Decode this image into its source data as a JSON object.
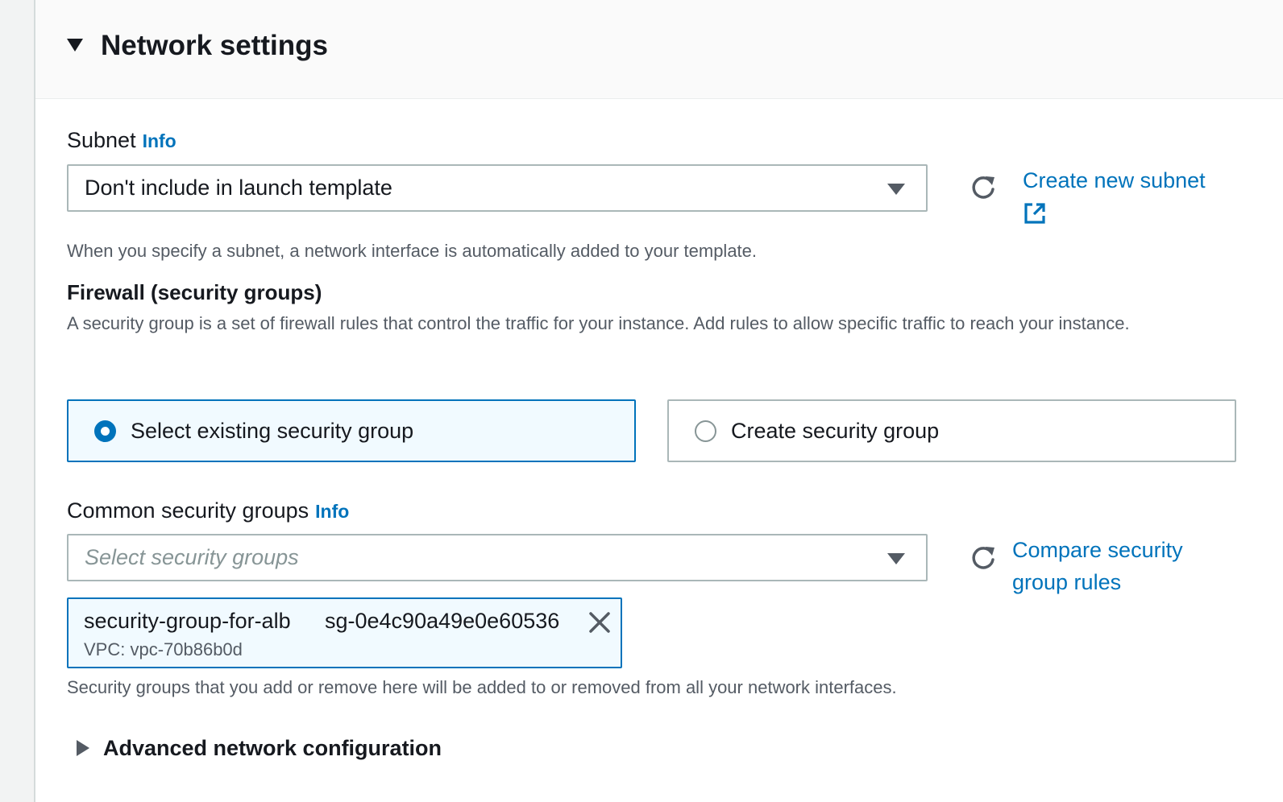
{
  "section": {
    "title": "Network settings"
  },
  "subnet": {
    "label": "Subnet",
    "info": "Info",
    "selected_value": "Don't include in launch template",
    "create_link": "Create new subnet",
    "help": "When you specify a subnet, a network interface is automatically added to your template."
  },
  "firewall": {
    "heading": "Firewall (security groups)",
    "description": "A security group is a set of firewall rules that control the traffic for your instance. Add rules to allow specific traffic to reach your instance.",
    "options": [
      {
        "label": "Select existing security group",
        "selected": true
      },
      {
        "label": "Create security group",
        "selected": false
      }
    ]
  },
  "common_sg": {
    "label": "Common security groups",
    "info": "Info",
    "placeholder": "Select security groups",
    "compare_link_line1": "Compare security",
    "compare_link_line2": "group rules",
    "token": {
      "name": "security-group-for-alb",
      "id": "sg-0e4c90a49e0e60536",
      "vpc": "VPC: vpc-70b86b0d"
    },
    "help": "Security groups that you add or remove here will be added to or removed from all your network interfaces."
  },
  "advanced": {
    "title": "Advanced network configuration"
  },
  "colors": {
    "link": "#0073bb",
    "selected_bg": "#f1faff",
    "border": "#aab7b8",
    "text": "#16191f",
    "muted": "#545b64"
  },
  "icons": [
    "caret-down-icon",
    "refresh-icon",
    "external-link-icon",
    "close-icon",
    "caret-right-icon"
  ]
}
